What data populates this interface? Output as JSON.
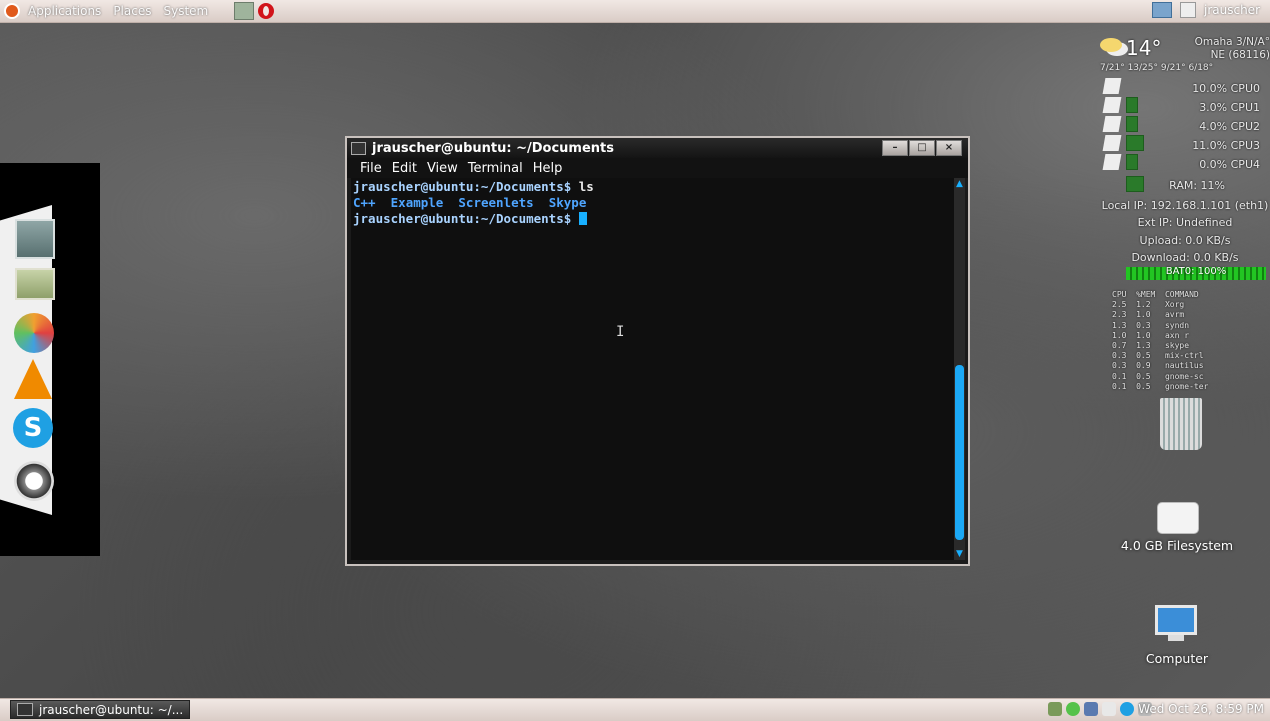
{
  "top_panel": {
    "menus": [
      "Applications",
      "Places",
      "System"
    ],
    "user": "jrauscher"
  },
  "terminal": {
    "title": "jrauscher@ubuntu: ~/Documents",
    "menu": [
      "File",
      "Edit",
      "View",
      "Terminal",
      "Help"
    ],
    "window_buttons": [
      "–",
      "□",
      "×"
    ],
    "lines": {
      "l1_prompt": "jrauscher@ubuntu:~/Documents$",
      "l1_cmd": " ls",
      "dirs": [
        "C++",
        "Example",
        "Screenlets",
        "Skype"
      ],
      "l3_prompt": "jrauscher@ubuntu:~/Documents$"
    }
  },
  "conky": {
    "temp": "14°",
    "location": "Omaha 3/N/A°",
    "wind": "NE (68116)",
    "forecast": "7/21°  13/25°  9/21°  6/18°",
    "cpus": [
      "10.0% CPU0",
      "3.0% CPU1",
      "4.0% CPU2",
      "11.0% CPU3",
      "0.0% CPU4"
    ],
    "ram": "RAM: 11%",
    "local_ip": "Local IP: 192.168.1.101 (eth1)",
    "ext_ip": "Ext IP: Undefined",
    "upload": "Upload: 0.0 KB/s",
    "download": "Download: 0.0 KB/s",
    "battery": "BAT0: 100%",
    "processes": "CPU  %MEM  COMMAND\n2.5  1.2   Xorg\n2.3  1.0   avrm\n1.3  0.3   syndn\n1.0  1.0   axn r\n0.7  1.3   skype\n0.3  0.5   mix-ctrl\n0.3  0.9   nautilus\n0.1  0.5   gnome-sc\n0.1  0.5   gnome-ter"
  },
  "desktop_icons": {
    "filesystem": "4.0 GB Filesystem",
    "computer": "Computer"
  },
  "bottom_panel": {
    "task": "jrauscher@ubuntu: ~/...",
    "clock": "Wed Oct 26, 8:59 PM"
  }
}
